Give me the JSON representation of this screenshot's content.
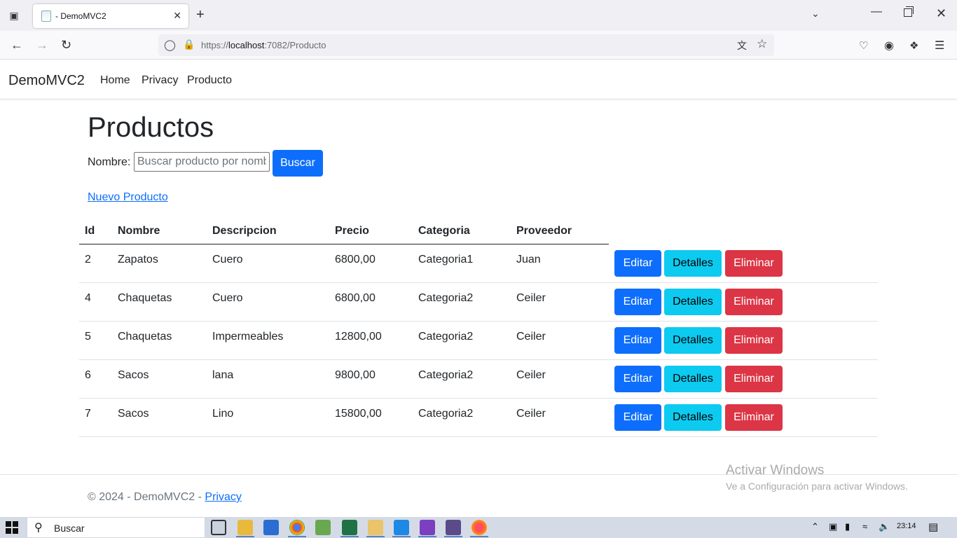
{
  "browser": {
    "tab_title": "- DemoMVC2",
    "url_prefix": "https://",
    "url_host": "localhost",
    "url_path": ":7082/Producto"
  },
  "navbar": {
    "brand": "DemoMVC2",
    "links": [
      "Home",
      "Privacy",
      "Producto"
    ]
  },
  "page": {
    "title": "Productos",
    "search_label": "Nombre:",
    "search_placeholder": "Buscar producto por nombre",
    "search_button": "Buscar",
    "new_link": "Nuevo Producto"
  },
  "table": {
    "headers": [
      "Id",
      "Nombre",
      "Descripcion",
      "Precio",
      "Categoria",
      "Proveedor"
    ],
    "rows": [
      [
        "2",
        "Zapatos",
        "Cuero",
        "6800,00",
        "Categoria1",
        "Juan"
      ],
      [
        "4",
        "Chaquetas",
        "Cuero",
        "6800,00",
        "Categoria2",
        "Ceiler"
      ],
      [
        "5",
        "Chaquetas",
        "Impermeables",
        "12800,00",
        "Categoria2",
        "Ceiler"
      ],
      [
        "6",
        "Sacos",
        "lana",
        "9800,00",
        "Categoria2",
        "Ceiler"
      ],
      [
        "7",
        "Sacos",
        "Lino",
        "15800,00",
        "Categoria2",
        "Ceiler"
      ]
    ],
    "actions": {
      "edit": "Editar",
      "details": "Detalles",
      "delete": "Eliminar"
    }
  },
  "footer": {
    "text": "© 2024 - DemoMVC2 - ",
    "link": "Privacy"
  },
  "watermark": {
    "title": "Activar Windows",
    "subtitle": "Ve a Configuración para activar Windows."
  },
  "taskbar": {
    "search": "Buscar",
    "time": "23:14"
  },
  "colors": {
    "primary": "#0d6efd",
    "info": "#0dcaf0",
    "danger": "#dc3545"
  }
}
